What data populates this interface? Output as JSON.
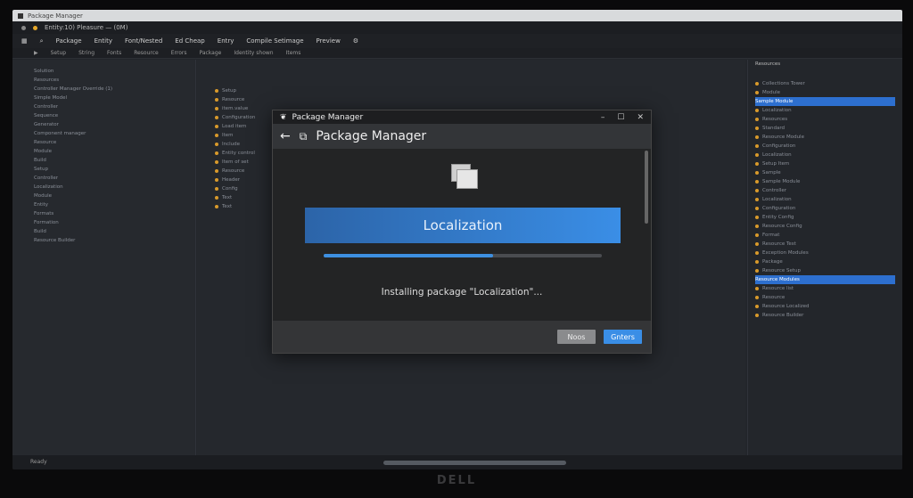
{
  "window": {
    "title": "Package Manager",
    "info": "Entity:10) Pleasure — (0M)"
  },
  "menu": [
    "Package",
    "Entity",
    "Font/Nested",
    "Ed Cheap",
    "Entry",
    "Compile Setimage",
    "Preview"
  ],
  "toolbar": [
    "Setup",
    "String",
    "Fonts",
    "Resource",
    "Errors",
    "Package",
    "Identity shown",
    "Items"
  ],
  "left_tree": [
    "Solution",
    "Resources",
    "Controller Manager Override (1)",
    "Simple Model",
    "Controller",
    "Sequence",
    "Generator",
    "Component manager",
    "Resource",
    "Module",
    "Build",
    "Setup",
    "Controller",
    "Localization",
    "Module",
    "Entity",
    "Formats",
    "Formation",
    "Build",
    "Resource Builder"
  ],
  "editor_lines": [
    "Setup",
    "Resource",
    "item.value",
    "Configuration",
    "Load item",
    "Item",
    "Include",
    "Entity control",
    "Item of set",
    "Resource",
    "Header",
    "Config",
    "Text",
    "Text"
  ],
  "right_panel": {
    "title": "Resources",
    "items": [
      "Collections Tower",
      "Module",
      "Sample Module",
      "Localization",
      "Resources",
      "Standard",
      "Resource Module",
      "Configuration",
      "Localization",
      "Setup Item",
      "Sample",
      "Sample Module",
      "Controller",
      "Localization",
      "Configuration",
      "Entity Config",
      "Resource Config",
      "Format",
      "Resource Test",
      "Exception Modules",
      "Package",
      "Resource Setup",
      "Resource Modules",
      "Resource list",
      "Resource",
      "Resource Localized",
      "Resource Builder"
    ]
  },
  "status": "Ready",
  "dialog": {
    "title": "Package Manager",
    "header": "Package Manager",
    "package_name": "Localization",
    "progress_percent": 61,
    "status_text": "Installing package \"Localization\"...",
    "secondary_button": "Noos",
    "primary_button": "Gnters",
    "accent": "#3a8ee6"
  },
  "brand": "DELL"
}
